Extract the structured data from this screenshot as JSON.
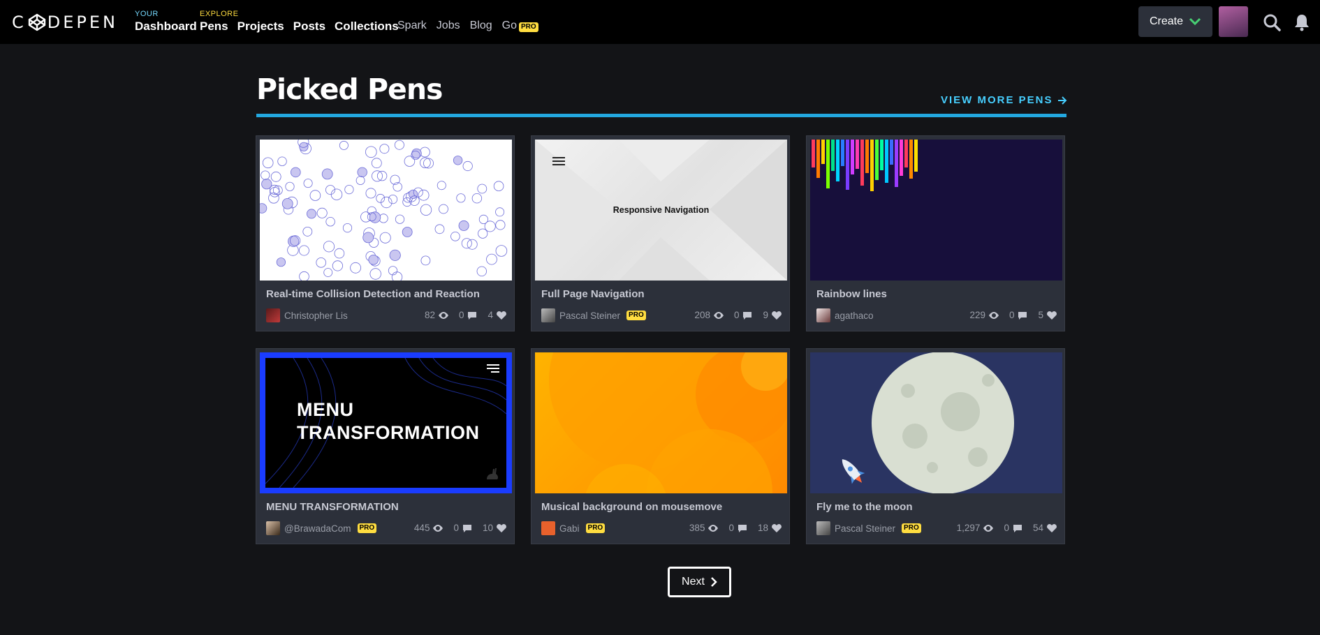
{
  "nav": {
    "brand": "CODEPEN",
    "your_label": "YOUR",
    "dashboard": "Dashboard",
    "explore_label": "EXPLORE",
    "pens": "Pens",
    "projects": "Projects",
    "posts": "Posts",
    "collections": "Collections",
    "spark": "Spark",
    "jobs": "Jobs",
    "blog": "Blog",
    "go": "Go",
    "go_badge": "PRO",
    "create": "Create"
  },
  "section": {
    "title": "Picked Pens",
    "view_more": "VIEW MORE PENS"
  },
  "cards": [
    {
      "title": "Real-time Collision Detection and Reaction",
      "author": "Christopher Lis",
      "pro": "",
      "views": "82",
      "comments": "0",
      "likes": "4",
      "thumb": "bubbles"
    },
    {
      "title": "Full Page Navigation",
      "author": "Pascal Steiner",
      "pro": "PRO",
      "views": "208",
      "comments": "0",
      "likes": "9",
      "thumb": "nav",
      "thumb_text": "Responsive Navigation"
    },
    {
      "title": "Rainbow lines",
      "author": "agathaco",
      "pro": "",
      "views": "229",
      "comments": "0",
      "likes": "5",
      "thumb": "rainbow"
    },
    {
      "title": "MENU TRANSFORMATION",
      "author": "@BrawadaCom",
      "pro": "PRO",
      "views": "445",
      "comments": "0",
      "likes": "10",
      "thumb": "menu",
      "thumb_text_1": "MENU",
      "thumb_text_2": "TRANSFORMATION"
    },
    {
      "title": "Musical background on mousemove",
      "author": "Gabi",
      "pro": "PRO",
      "views": "385",
      "comments": "0",
      "likes": "18",
      "thumb": "orange"
    },
    {
      "title": "Fly me to the moon",
      "author": "Pascal Steiner",
      "pro": "PRO",
      "views": "1,297",
      "comments": "0",
      "likes": "54",
      "thumb": "moon"
    }
  ],
  "pagination": {
    "next": "Next"
  },
  "colors": {
    "accent": "#47cfff",
    "pro": "#ffdd40",
    "card_bg": "#2c303a",
    "page_bg": "#131417"
  }
}
